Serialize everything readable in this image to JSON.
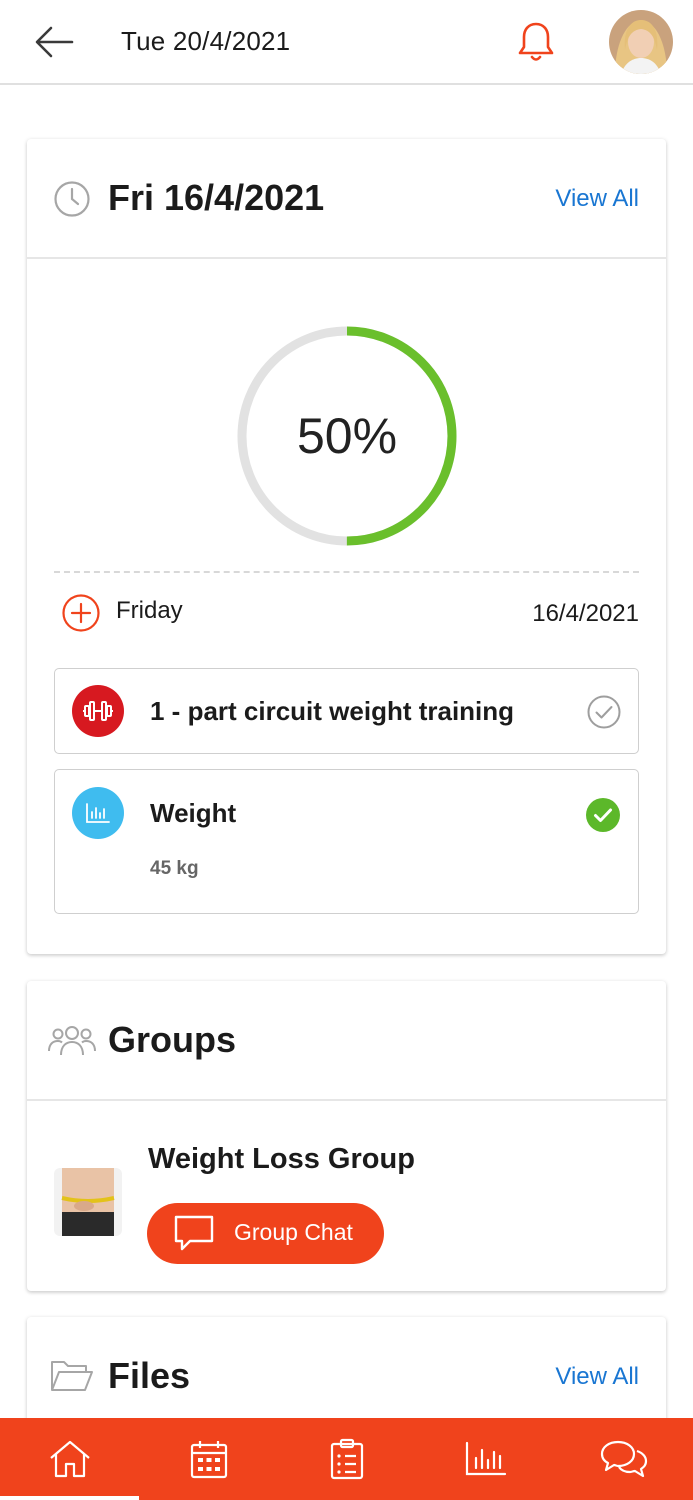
{
  "header": {
    "date": "Tue 20/4/2021",
    "icons": {
      "back": "arrow-left-icon",
      "notifications": "bell-icon",
      "avatar": "user-avatar"
    }
  },
  "day_card": {
    "title": "Fri 16/4/2021",
    "view_all": "View All",
    "progress": {
      "label": "50%",
      "value": 0.5
    },
    "day_name": "Friday",
    "day_date": "16/4/2021",
    "tasks": [
      {
        "title": "1 - part circuit weight training",
        "icon": "dumbbell-icon",
        "color": "#d71920",
        "completed": false
      },
      {
        "title": "Weight",
        "subtitle": "45 kg",
        "icon": "bar-chart-icon",
        "color": "#3fbcef",
        "completed": true
      }
    ]
  },
  "groups_card": {
    "title": "Groups",
    "group": {
      "name": "Weight Loss Group",
      "chat_button": "Group Chat"
    }
  },
  "files_card": {
    "title": "Files",
    "view_all": "View All"
  },
  "bottom_nav": {
    "items": [
      "home-icon",
      "calendar-icon",
      "clipboard-list-icon",
      "bar-chart-icon",
      "chat-bubbles-icon"
    ],
    "active_index": 0
  },
  "colors": {
    "accent": "#f0431c",
    "link": "#1976d2",
    "progress_done": "#6abf2c",
    "progress_track": "#e2e2e2",
    "check_done": "#5cb82a"
  }
}
